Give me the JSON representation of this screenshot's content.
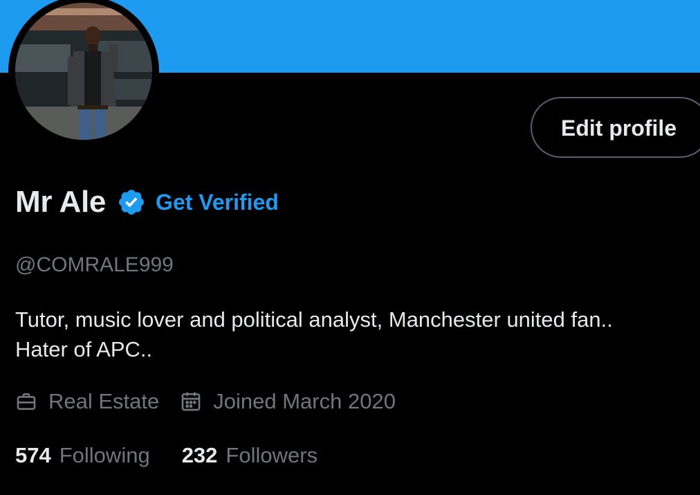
{
  "colors": {
    "banner": "#1d9bf0",
    "accent": "#1d9bf0",
    "background": "#000000",
    "primary_text": "#e7e9ea",
    "secondary_text": "#71767b",
    "button_border": "#536471"
  },
  "profile": {
    "avatar_icon": "profile-photo",
    "edit_button_label": "Edit profile",
    "display_name": "Mr Ale",
    "verified_icon": "verified-badge-icon",
    "get_verified_label": "Get Verified",
    "handle": "@COMRALE999",
    "bio_lines": [
      "Tutor, music lover and political analyst, Manchester united fan..",
      "Hater of APC.."
    ],
    "meta": {
      "profession_icon": "briefcase-icon",
      "profession": "Real Estate",
      "joined_icon": "calendar-icon",
      "joined": "Joined March 2020"
    },
    "stats": {
      "following_count": "574",
      "following_label": "Following",
      "followers_count": "232",
      "followers_label": "Followers"
    }
  }
}
